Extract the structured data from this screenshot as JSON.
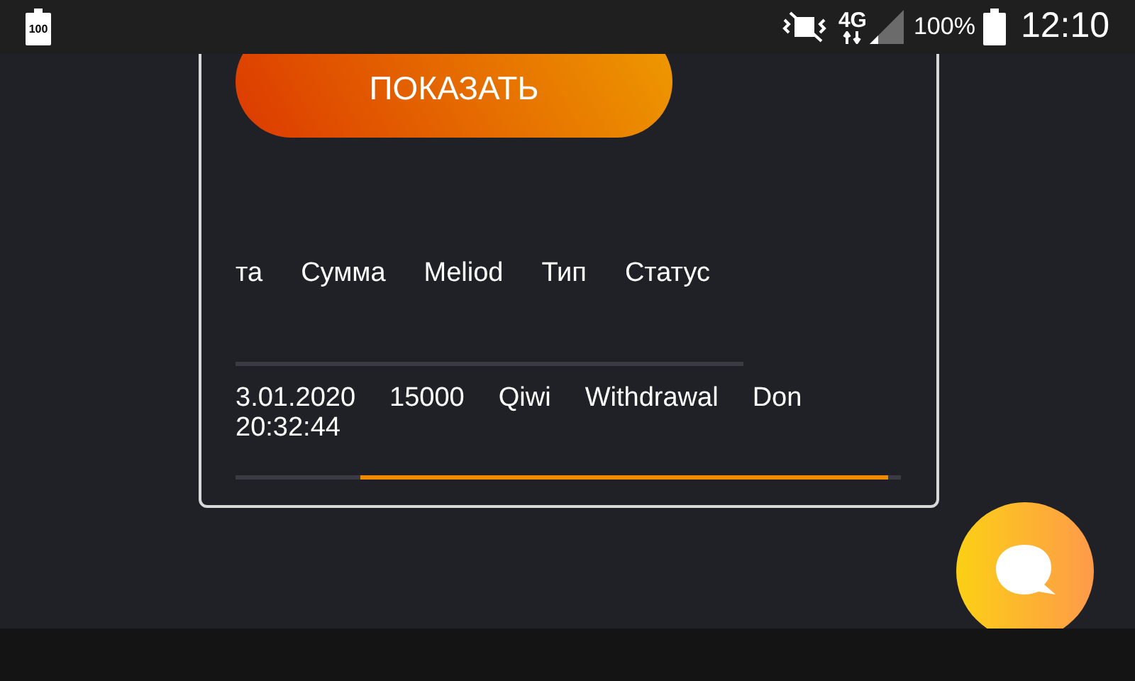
{
  "status_bar": {
    "left_battery_label": "100",
    "network": "4G",
    "battery_percent": "100%",
    "time": "12:10"
  },
  "show_button": {
    "label": "ПОКАЗАТЬ"
  },
  "header_labels": [
    "та",
    "Сумма",
    "Meliod",
    "Тип",
    "Статус"
  ],
  "transactions": [
    {
      "date": "3.01.2020\n20:32:44",
      "amount": "15000",
      "method": "Qiwi",
      "type": "Withdrawal",
      "status": "Don"
    }
  ]
}
